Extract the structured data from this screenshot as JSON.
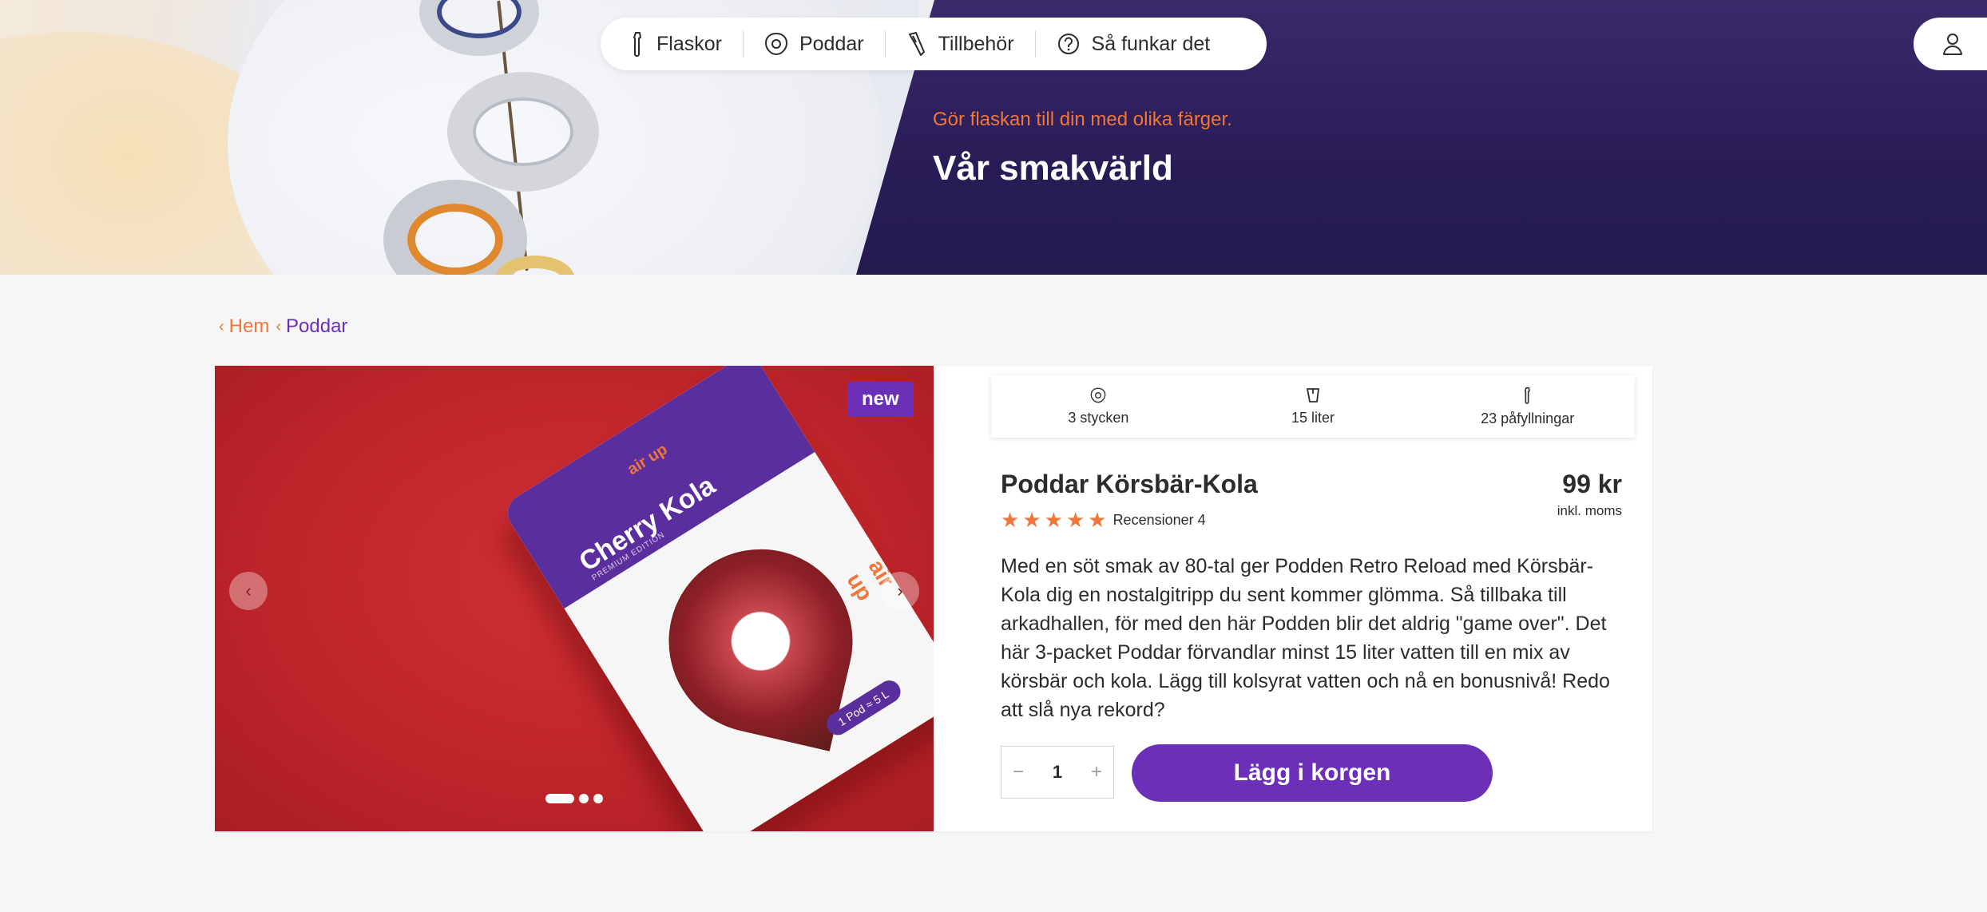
{
  "nav": {
    "items": [
      {
        "label": "Flaskor",
        "icon": "bottle-icon"
      },
      {
        "label": "Poddar",
        "icon": "pod-icon"
      },
      {
        "label": "Tillbehör",
        "icon": "accessory-icon"
      },
      {
        "label": "Så funkar det",
        "icon": "question-icon"
      }
    ],
    "account_icon": "user-icon"
  },
  "hero": {
    "subtitle": "Gör flaskan till din med olika färger.",
    "title": "Vår smakvärld"
  },
  "breadcrumb": {
    "home": "Hem",
    "current": "Poddar"
  },
  "product": {
    "badge": "new",
    "stats": [
      {
        "label": "3 stycken",
        "icon": "pod-icon"
      },
      {
        "label": "15 liter",
        "icon": "cup-icon"
      },
      {
        "label": "23 påfyllningar",
        "icon": "bottle-icon"
      }
    ],
    "name": "Poddar Körsbär-Kola",
    "rating": 5,
    "reviews_label": "Recensioner 4",
    "price": "99 kr",
    "price_note": "inkl. moms",
    "description": "Med en söt smak av 80-tal ger Podden Retro Reload med Körsbär-Kola dig en nostalgitripp du sent kommer glömma. Så tillbaka till arkadhallen, för med den här Podden blir det aldrig \"game over\". Det här 3-packet Poddar förvandlar minst 15 liter vatten till en mix av körsbär och kola. Lägg till kolsyrat vatten och nå en bonusnivå! Redo att slå nya rekord?",
    "quantity": "1",
    "add_to_cart": "Lägg i korgen",
    "gallery": {
      "slides": 3,
      "active_slide": 1,
      "pouch_brand": "air up",
      "pouch_name": "Cherry Kola",
      "pouch_edition": "PREMIUM EDITION",
      "pouch_pill": "1 Pod ≈ 5 L"
    }
  },
  "colors": {
    "accent_orange": "#f0763a",
    "brand_purple": "#6b2fb8",
    "hero_dark": "#2a1d58"
  }
}
